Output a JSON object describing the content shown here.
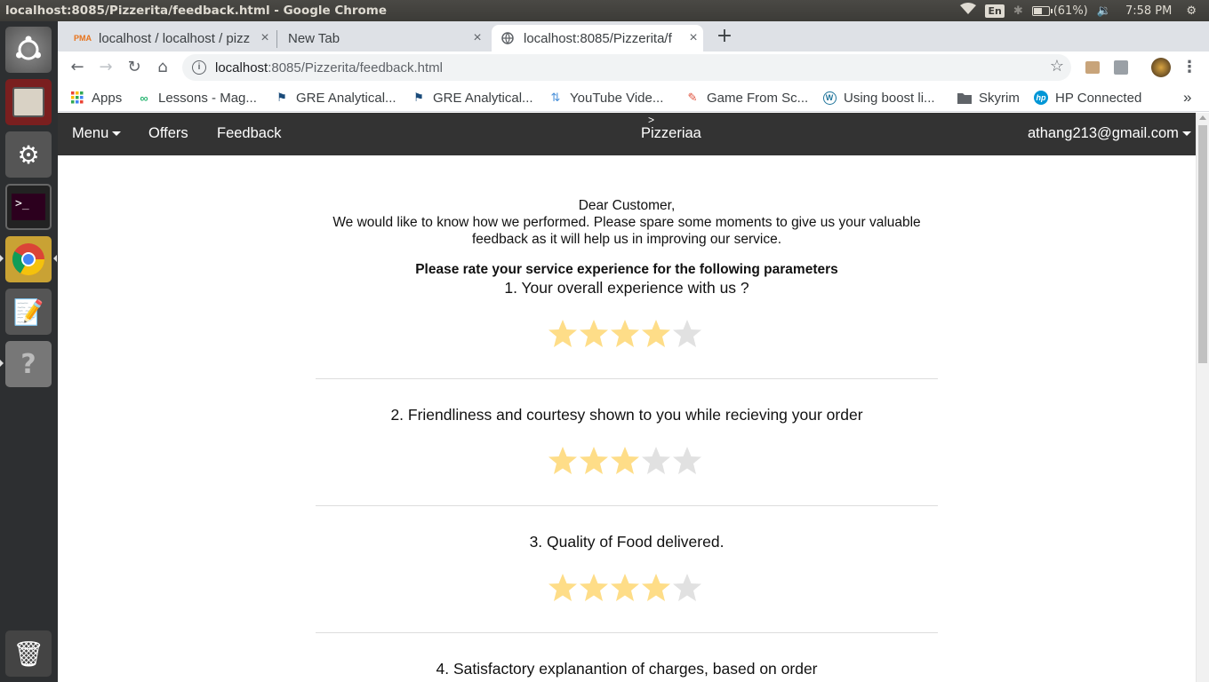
{
  "os": {
    "window_title": "localhost:8085/Pizzerita/feedback.html - Google Chrome",
    "keyboard": "En",
    "battery": "(61%)",
    "battery_level": 0.61,
    "clock": "7:58 PM"
  },
  "browser": {
    "tabs": [
      {
        "label": "localhost / localhost / pizz",
        "icon": "phpmyadmin-icon"
      },
      {
        "label": "New Tab",
        "icon": "none"
      },
      {
        "label": "localhost:8085/Pizzerita/f",
        "icon": "globe-icon"
      }
    ],
    "url_host": "localhost",
    "url_rest": ":8085/Pizzerita/feedback.html",
    "bookmarks": [
      {
        "label": "Apps",
        "icon": "apps-grid-icon"
      },
      {
        "label": "Lessons - Mag...",
        "icon": "magoosh-icon"
      },
      {
        "label": "GRE Analytical...",
        "icon": "flag-icon"
      },
      {
        "label": "GRE Analytical...",
        "icon": "flag-icon"
      },
      {
        "label": "YouTube Vide...",
        "icon": "converter-icon"
      },
      {
        "label": "Game From Sc...",
        "icon": "pencil-icon"
      },
      {
        "label": "Using boost li...",
        "icon": "wordpress-icon"
      },
      {
        "label": "Skyrim",
        "icon": "folder-icon"
      },
      {
        "label": "HP Connected",
        "icon": "hp-icon"
      }
    ],
    "overflow": "»"
  },
  "site": {
    "nav": {
      "menu": "Menu",
      "offers": "Offers",
      "feedback": "Feedback",
      "brand_mark": ">",
      "brand": "Pizzeriaa",
      "user": "athang213@gmail.com"
    },
    "greeting": "Dear Customer,",
    "intro_line1": "We would like to know how we performed. Please spare some moments to give us your valuable",
    "intro_line2": "feedback as it will help us in improving our service.",
    "rate_title": "Please rate your service experience for the following parameters",
    "questions": [
      {
        "text": "1. Your overall experience with us ?",
        "rating": 4,
        "max": 5
      },
      {
        "text": "2. Friendliness and courtesy shown to you while recieving your order",
        "rating": 3,
        "max": 5
      },
      {
        "text": "3. Quality of Food delivered.",
        "rating": 4,
        "max": 5
      },
      {
        "text": "4. Satisfactory explanantion of charges, based on order",
        "rating": null,
        "max": 5
      }
    ],
    "colors": {
      "star_on": "#fedd88",
      "star_off": "#e1e1e1",
      "navbar": "#333333"
    }
  }
}
